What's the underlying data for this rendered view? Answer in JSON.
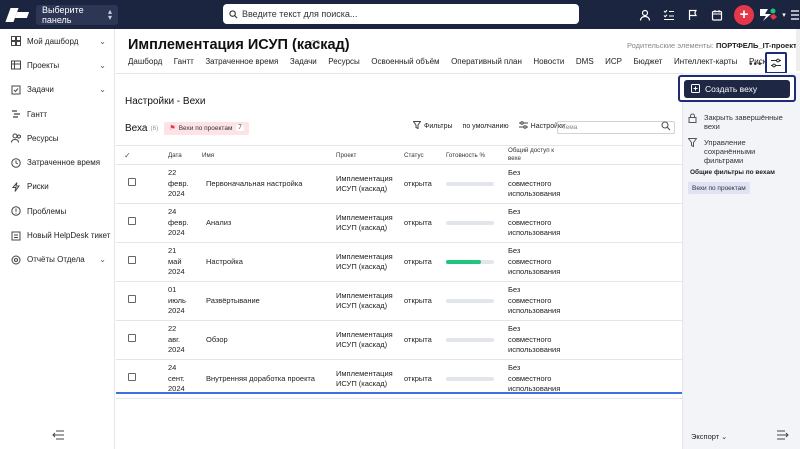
{
  "topbar": {
    "panel_select": "Выберите панель",
    "search_placeholder": "Введите текст для поиска..."
  },
  "sidebar": {
    "items": [
      {
        "label": "Мой дашборд",
        "icon": "dashboard-icon",
        "has_chevron": true
      },
      {
        "label": "Проекты",
        "icon": "projects-icon",
        "has_chevron": true
      },
      {
        "label": "Задачи",
        "icon": "tasks-icon",
        "has_chevron": true
      },
      {
        "label": "Гантт",
        "icon": "gantt-icon",
        "has_chevron": false
      },
      {
        "label": "Ресурсы",
        "icon": "resources-icon",
        "has_chevron": false
      },
      {
        "label": "Затраченное время",
        "icon": "clock-icon",
        "has_chevron": false
      },
      {
        "label": "Риски",
        "icon": "risks-icon",
        "has_chevron": false
      },
      {
        "label": "Проблемы",
        "icon": "problems-icon",
        "has_chevron": false
      },
      {
        "label": "Новый HelpDesk тикет",
        "icon": "helpdesk-icon",
        "has_chevron": false
      },
      {
        "label": "Отчёты Отдела",
        "icon": "reports-icon",
        "has_chevron": true
      }
    ]
  },
  "header": {
    "title": "Имплементация ИСУП (каскад)",
    "parents_label": "Родительские элементы:",
    "parents_value": "ПОРТФЕЛЬ_IT-проекты",
    "tabs": [
      "Дашборд",
      "Гантт",
      "Затраченное время",
      "Задачи",
      "Ресурсы",
      "Освоенный объём",
      "Оперативный план",
      "Новости",
      "DMS",
      "ИСР",
      "Бюджет",
      "Интеллект-карты",
      "Риски"
    ]
  },
  "section": {
    "title": "Настройки - Вехи",
    "list_title": "Веха",
    "count": "(6)",
    "chip_label": "Вехи по проектам",
    "chip_count": "7",
    "filters_label": "Фильтры",
    "default_label": "по умолчанию",
    "settings_label": "Настройки",
    "search_placeholder": "Тема"
  },
  "table": {
    "columns": [
      "Дата",
      "Имя",
      "Проект",
      "Статус",
      "Готовность %",
      "Общий доступ к вехе"
    ],
    "rows": [
      {
        "date": [
          "22",
          "февр.",
          "2024"
        ],
        "name": "Первоначальная настройка",
        "project": [
          "Имплементация",
          "ИСУП (каскад)"
        ],
        "status": "открыта",
        "progress": 0,
        "sharing": [
          "Без",
          "совместного",
          "использования"
        ]
      },
      {
        "date": [
          "24",
          "февр.",
          "2024"
        ],
        "name": "Анализ",
        "project": [
          "Имплементация",
          "ИСУП (каскад)"
        ],
        "status": "открыта",
        "progress": 0,
        "sharing": [
          "Без",
          "совместного",
          "использования"
        ]
      },
      {
        "date": [
          "21",
          "май",
          "2024"
        ],
        "name": "Настройка",
        "project": [
          "Имплементация",
          "ИСУП (каскад)"
        ],
        "status": "открыта",
        "progress": 0.72,
        "sharing": [
          "Без",
          "совместного",
          "использования"
        ]
      },
      {
        "date": [
          "01",
          "июль",
          "2024"
        ],
        "name": "Развёртывание",
        "project": [
          "Имплементация",
          "ИСУП (каскад)"
        ],
        "status": "открыта",
        "progress": 0,
        "sharing": [
          "Без",
          "совместного",
          "использования"
        ]
      },
      {
        "date": [
          "22",
          "авг.",
          "2024"
        ],
        "name": "Обзор",
        "project": [
          "Имплементация",
          "ИСУП (каскад)"
        ],
        "status": "открыта",
        "progress": 0,
        "sharing": [
          "Без",
          "совместного",
          "использования"
        ]
      },
      {
        "date": [
          "24",
          "сент.",
          "2024"
        ],
        "name": "Внутренняя доработка проекта",
        "project": [
          "Имплементация",
          "ИСУП (каскад)"
        ],
        "status": "открыта",
        "progress": 0,
        "sharing": [
          "Без",
          "совместного",
          "использования"
        ]
      }
    ]
  },
  "right_panel": {
    "create_button": "Создать веху",
    "close_completed": "Закрыть завершённые вехи",
    "manage_filters": "Управление сохранёнными фильтрами",
    "filters_heading": "Общие фильтры по вехам",
    "filter_chip": "Вехи по проектам",
    "export_label": "Экспорт"
  },
  "colors": {
    "topbar": "#1b2540",
    "accent_red": "#e6374a",
    "progress_green": "#22c57d",
    "create_button": "#1e2744",
    "highlight_border": "#1e2a7a"
  }
}
